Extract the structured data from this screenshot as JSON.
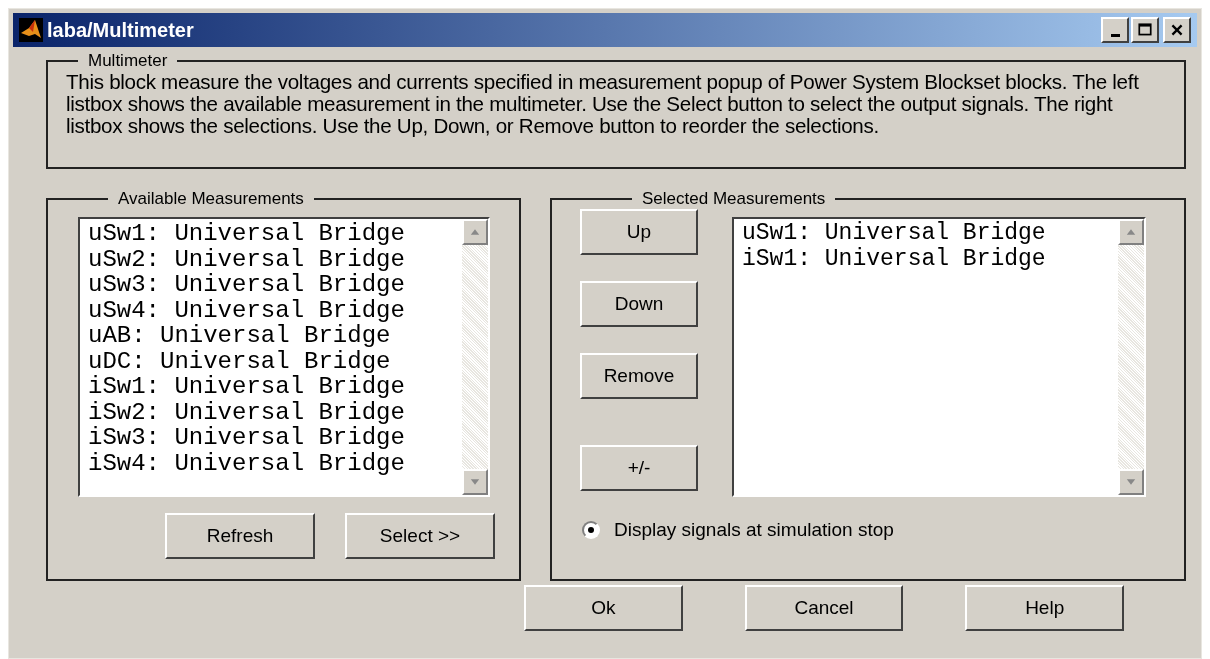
{
  "window": {
    "title": "laba/Multimeter"
  },
  "description": {
    "title": "Multimeter",
    "text": "This block measure the voltages and currents specified in measurement popup of Power System Blockset blocks. The left listbox shows the available measurement in the multimeter. Use the Select button to select the output signals. The right listbox shows the selections. Use the Up, Down, or Remove button to reorder the selections."
  },
  "available": {
    "title": "Available Measurements",
    "items": [
      "uSw1: Universal Bridge",
      "uSw2: Universal Bridge",
      "uSw3: Universal Bridge",
      "uSw4: Universal Bridge",
      "uAB: Universal Bridge",
      "uDC: Universal Bridge",
      "iSw1: Universal Bridge",
      "iSw2: Universal Bridge",
      "iSw3: Universal Bridge",
      "iSw4: Universal Bridge"
    ],
    "buttons": [
      "Refresh",
      "Select >>"
    ]
  },
  "selected": {
    "title": "Selected Measurements",
    "buttons": [
      "Up",
      "Down",
      "Remove",
      "+/-"
    ],
    "items": [
      "uSw1: Universal Bridge",
      "iSw1: Universal Bridge"
    ],
    "option": {
      "label": "Display signals at simulation stop",
      "checked": true
    }
  },
  "buttons": [
    "Ok",
    "Cancel",
    "Help"
  ]
}
